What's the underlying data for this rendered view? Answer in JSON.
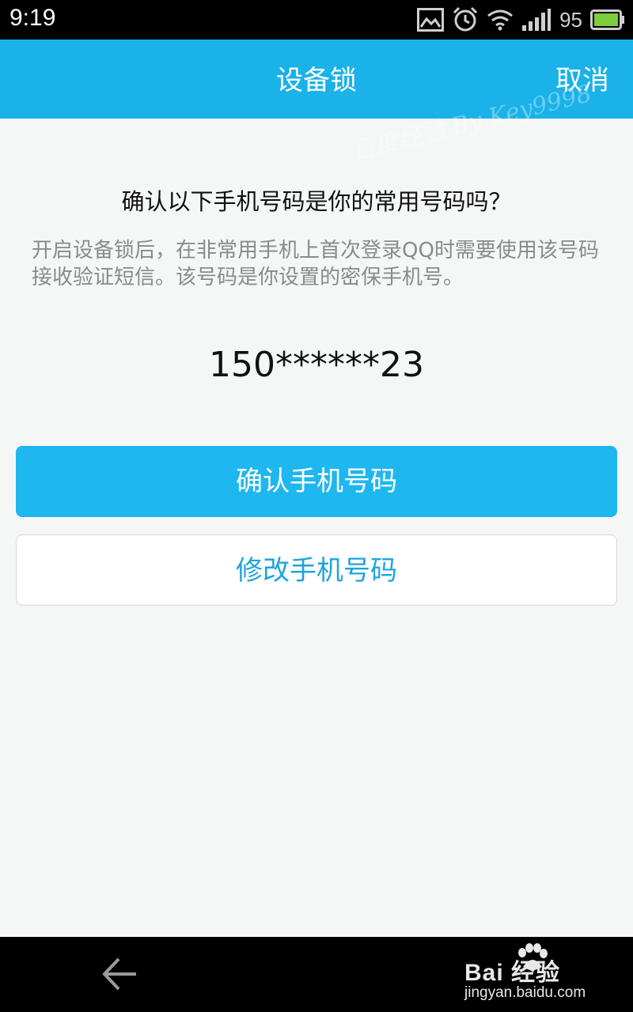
{
  "status_bar": {
    "time": "9:19",
    "battery_level": "95",
    "icons": [
      "image-icon",
      "alarm-icon",
      "wifi-icon",
      "signal-icon",
      "battery-icon"
    ]
  },
  "header": {
    "title": "设备锁",
    "cancel_label": "取消",
    "watermark": "百度经验 By Key9998"
  },
  "main": {
    "question": "确认以下手机号码是你的常用号码吗？",
    "description": "开启设备锁后，在非常用手机上首次登录QQ时需要使用该号码接收验证短信。该号码是你设置的密保手机号。",
    "phone_number": "150******23",
    "confirm_button": "确认手机号码",
    "modify_button": "修改手机号码"
  },
  "nav_bar": {
    "back_icon": "back-arrow-icon",
    "brand_text": "Bai 经验",
    "brand_url": "jingyan.baidu.com"
  },
  "colors": {
    "accent": "#1ab2e8",
    "button_primary": "#1fb7ef",
    "button_secondary_text": "#1ea4df",
    "background": "#f5f7f7"
  }
}
